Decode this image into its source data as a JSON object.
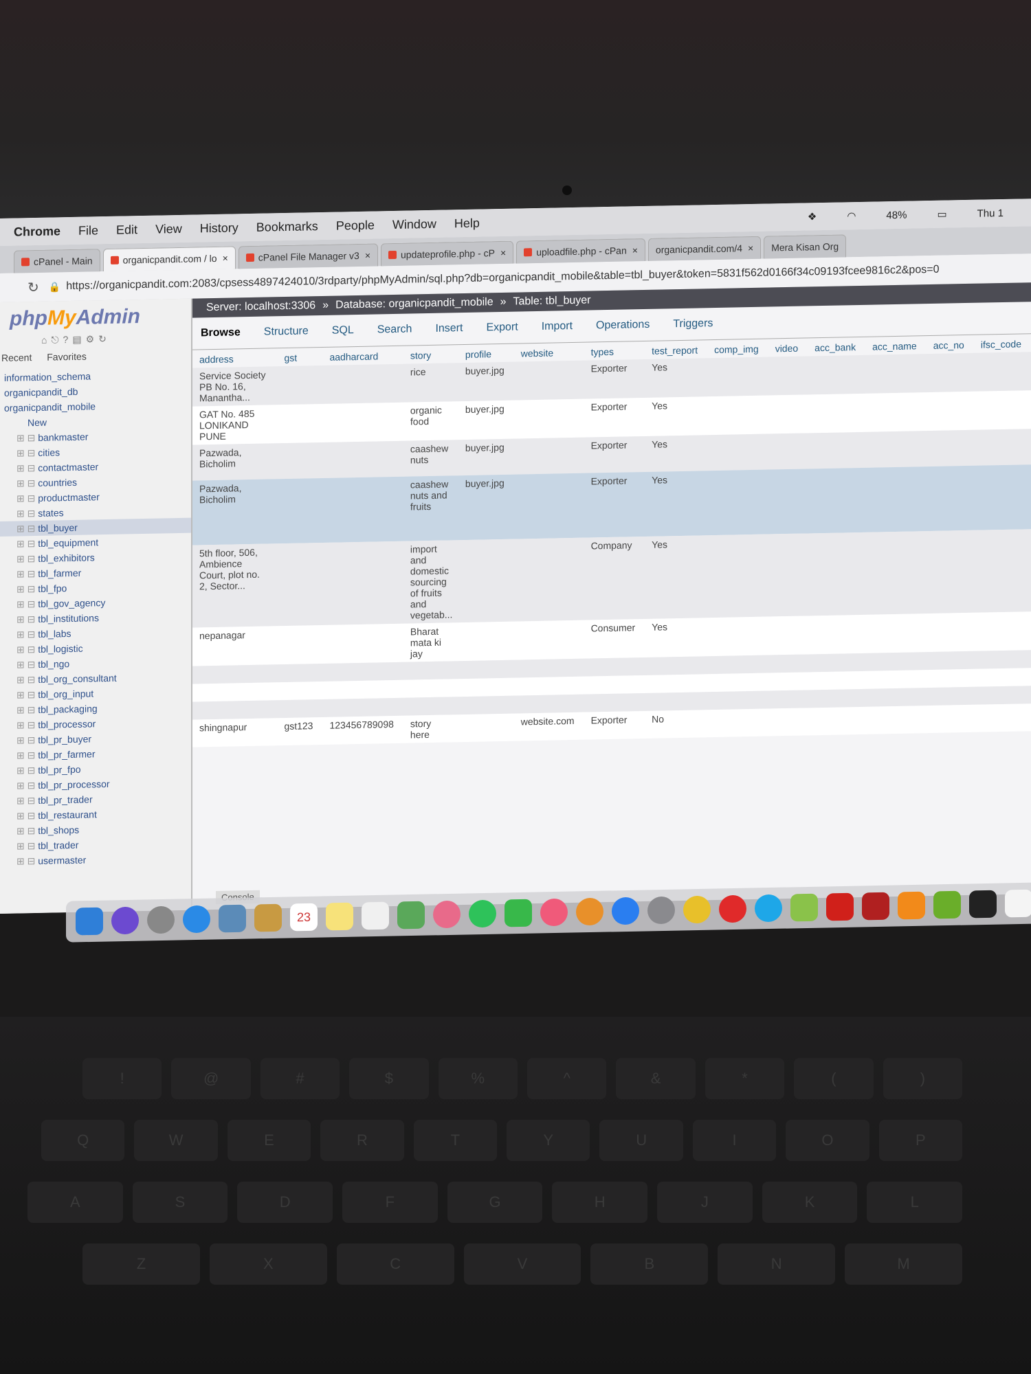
{
  "menubar": {
    "app": "Chrome",
    "items": [
      "File",
      "Edit",
      "View",
      "History",
      "Bookmarks",
      "People",
      "Window",
      "Help"
    ],
    "battery": "48%",
    "clock": "Thu 1"
  },
  "tabs": [
    {
      "label": "cPanel - Main"
    },
    {
      "label": "organicpandit.com / lo"
    },
    {
      "label": "cPanel File Manager v3"
    },
    {
      "label": "updateprofile.php - cP"
    },
    {
      "label": "uploadfile.php - cPan"
    },
    {
      "label": "organicpandit.com/4"
    },
    {
      "label": "Mera Kisan Org"
    }
  ],
  "address_url": "https://organicpandit.com:2083/cpsess4897424010/3rdparty/phpMyAdmin/sql.php?db=organicpandit_mobile&table=tbl_buyer&token=5831f562d0166f34c09193fcee9816c2&pos=0",
  "logo": {
    "php": "php",
    "my": "My",
    "admin": "Admin"
  },
  "side": {
    "recent": "Recent",
    "favorites": "Favorites",
    "items": [
      {
        "label": "information_schema",
        "kind": "db"
      },
      {
        "label": "organicpandit_db",
        "kind": "db"
      },
      {
        "label": "organicpandit_mobile",
        "kind": "db"
      },
      {
        "label": "New",
        "kind": "new"
      },
      {
        "label": "bankmaster",
        "kind": "tbl"
      },
      {
        "label": "cities",
        "kind": "tbl"
      },
      {
        "label": "contactmaster",
        "kind": "tbl"
      },
      {
        "label": "countries",
        "kind": "tbl"
      },
      {
        "label": "productmaster",
        "kind": "tbl"
      },
      {
        "label": "states",
        "kind": "tbl"
      },
      {
        "label": "tbl_buyer",
        "kind": "tbl"
      },
      {
        "label": "tbl_equipment",
        "kind": "tbl"
      },
      {
        "label": "tbl_exhibitors",
        "kind": "tbl"
      },
      {
        "label": "tbl_farmer",
        "kind": "tbl"
      },
      {
        "label": "tbl_fpo",
        "kind": "tbl"
      },
      {
        "label": "tbl_gov_agency",
        "kind": "tbl"
      },
      {
        "label": "tbl_institutions",
        "kind": "tbl"
      },
      {
        "label": "tbl_labs",
        "kind": "tbl"
      },
      {
        "label": "tbl_logistic",
        "kind": "tbl"
      },
      {
        "label": "tbl_ngo",
        "kind": "tbl"
      },
      {
        "label": "tbl_org_consultant",
        "kind": "tbl"
      },
      {
        "label": "tbl_org_input",
        "kind": "tbl"
      },
      {
        "label": "tbl_packaging",
        "kind": "tbl"
      },
      {
        "label": "tbl_processor",
        "kind": "tbl"
      },
      {
        "label": "tbl_pr_buyer",
        "kind": "tbl"
      },
      {
        "label": "tbl_pr_farmer",
        "kind": "tbl"
      },
      {
        "label": "tbl_pr_fpo",
        "kind": "tbl"
      },
      {
        "label": "tbl_pr_processor",
        "kind": "tbl"
      },
      {
        "label": "tbl_pr_trader",
        "kind": "tbl"
      },
      {
        "label": "tbl_restaurant",
        "kind": "tbl"
      },
      {
        "label": "tbl_shops",
        "kind": "tbl"
      },
      {
        "label": "tbl_trader",
        "kind": "tbl"
      },
      {
        "label": "usermaster",
        "kind": "tbl"
      }
    ]
  },
  "breadcrumb": {
    "server": "Server: localhost:3306",
    "database": "Database: organicpandit_mobile",
    "table": "Table: tbl_buyer"
  },
  "toolbar": [
    "Browse",
    "Structure",
    "SQL",
    "Search",
    "Insert",
    "Export",
    "Import",
    "Operations",
    "Triggers"
  ],
  "table": {
    "columns": [
      "address",
      "gst",
      "aadharcard",
      "story",
      "profile",
      "website",
      "types",
      "test_report",
      "comp_img",
      "video",
      "acc_bank",
      "acc_name",
      "acc_no",
      "ifsc_code"
    ],
    "rows": [
      [
        "Service Society PB No. 16, Manantha...",
        "",
        "",
        "rice",
        "buyer.jpg",
        "",
        "Exporter",
        "Yes",
        "",
        "",
        "",
        "",
        "",
        ""
      ],
      [
        "GAT No. 485 LONIKAND PUNE",
        "",
        "",
        "organic food",
        "buyer.jpg",
        "",
        "Exporter",
        "Yes",
        "",
        "",
        "",
        "",
        "",
        ""
      ],
      [
        "Pazwada, Bicholim",
        "",
        "",
        "caashew nuts",
        "buyer.jpg",
        "",
        "Exporter",
        "Yes",
        "",
        "",
        "",
        "",
        "",
        ""
      ],
      [
        "Pazwada, Bicholim",
        "",
        "",
        "caashew nuts and fruits",
        "buyer.jpg",
        "",
        "Exporter",
        "Yes",
        "",
        "",
        "",
        "",
        "",
        ""
      ],
      [
        "5th floor, 506, Ambience Court, plot no. 2, Sector...",
        "",
        "",
        "import and domestic sourcing of fruits and vegetab...",
        "",
        "",
        "Company",
        "Yes",
        "",
        "",
        "",
        "",
        "",
        ""
      ],
      [
        "nepanagar",
        "",
        "",
        "Bharat mata ki jay",
        "",
        "",
        "Consumer",
        "Yes",
        "",
        "",
        "",
        "",
        "",
        ""
      ],
      [
        "",
        "",
        "",
        "",
        "",
        "",
        "",
        "",
        "",
        "",
        "",
        "",
        "",
        ""
      ],
      [
        "",
        "",
        "",
        "",
        "",
        "",
        "",
        "",
        "",
        "",
        "",
        "",
        "",
        ""
      ],
      [
        "",
        "",
        "",
        "",
        "",
        "",
        "",
        "",
        "",
        "",
        "",
        "",
        "",
        ""
      ],
      [
        "shingnapur",
        "gst123",
        "123456789098",
        "story here",
        "",
        "website.com",
        "Exporter",
        "No",
        "",
        "",
        "",
        "",
        "",
        ""
      ]
    ]
  },
  "console_label": "Console",
  "dock": {
    "icons": [
      "finder-icon",
      "siri-icon",
      "launchpad-icon",
      "safari-icon",
      "preview-icon",
      "folder-icon",
      "calendar-icon",
      "notes-icon",
      "textedit-icon",
      "maps-icon",
      "photos-icon",
      "messages-icon",
      "facetime-icon",
      "music-icon",
      "books-icon",
      "appstore-icon",
      "settings-icon",
      "chrome-icon",
      "opera-icon",
      "skype-icon",
      "android-icon",
      "acrobat-icon",
      "filezilla-icon",
      "vlc-icon",
      "utorrent-icon",
      "terminal-icon",
      "file-icon",
      "trash-icon"
    ],
    "colors": [
      "#2f7fd8",
      "#6c4ad0",
      "#888",
      "#2a8ae6",
      "#5b8bb8",
      "#c89a42",
      "#ffffff",
      "#f7e27a",
      "#f0f0f0",
      "#5aa85a",
      "#e86a8a",
      "#2ec25a",
      "#38b84a",
      "#f05a7a",
      "#e8902a",
      "#2a7ef0",
      "#8a8a8e",
      "#e8c02a",
      "#e02a2a",
      "#1ea7e8",
      "#8ac24a",
      "#d0201a",
      "#b02020",
      "#f28a1a",
      "#6aae2a",
      "#222222",
      "#f4f4f4",
      "#cfd4d8"
    ],
    "calendar_day": "23"
  },
  "keyboard": {
    "rows": [
      [
        "!",
        "@",
        "#",
        "$",
        "%",
        "^",
        "&",
        "*",
        "(",
        ")"
      ],
      [
        "Q",
        "W",
        "E",
        "R",
        "T",
        "Y",
        "U",
        "I",
        "O",
        "P"
      ],
      [
        "A",
        "S",
        "D",
        "F",
        "G",
        "H",
        "J",
        "K",
        "L"
      ],
      [
        "Z",
        "X",
        "C",
        "V",
        "B",
        "N",
        "M"
      ]
    ]
  }
}
